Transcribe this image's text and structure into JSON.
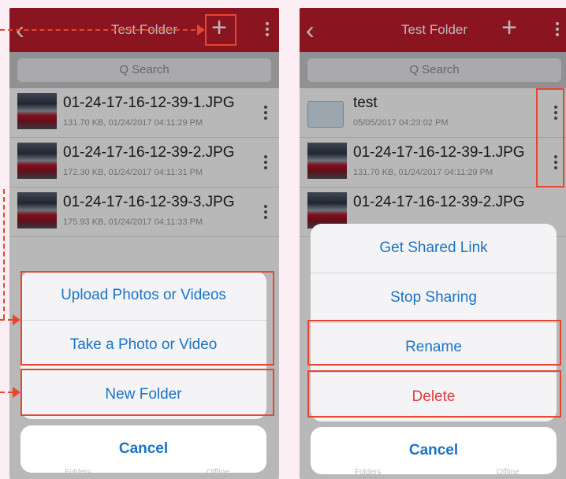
{
  "left": {
    "nav": {
      "title": "Test Folder",
      "back": "‹",
      "add": "+"
    },
    "search": {
      "placeholder": "Q Search"
    },
    "files": [
      {
        "name": "01-24-17-16-12-39-1.JPG",
        "meta": "131.70 KB, 01/24/2017 04:11:29 PM"
      },
      {
        "name": "01-24-17-16-12-39-2.JPG",
        "meta": "172.30 KB, 01/24/2017 04:11:31 PM"
      },
      {
        "name": "01-24-17-16-12-39-3.JPG",
        "meta": "175.93 KB, 01/24/2017 04:11:33 PM"
      }
    ],
    "sheet": {
      "items": [
        "Upload Photos or Videos",
        "Take a Photo or Video",
        "New Folder"
      ],
      "cancel": "Cancel"
    },
    "tabs": {
      "folders": "Folders",
      "offline": "Offline"
    }
  },
  "right": {
    "nav": {
      "title": "Test Folder",
      "back": "‹",
      "add": "+"
    },
    "search": {
      "placeholder": "Q Search"
    },
    "folder": {
      "name": "test",
      "meta": "05/05/2017 04:23:02 PM"
    },
    "files": [
      {
        "name": "01-24-17-16-12-39-1.JPG",
        "meta": "131.70 KB, 01/24/2017 04:11:29 PM"
      },
      {
        "name": "01-24-17-16-12-39-2.JPG",
        "meta": ""
      }
    ],
    "sheet": {
      "items": [
        "Get Shared Link",
        "Stop Sharing",
        "Rename",
        "Delete"
      ],
      "cancel": "Cancel"
    },
    "tabs": {
      "folders": "Folders",
      "offline": "Offline"
    }
  },
  "colors": {
    "nav": "#bf1e2e",
    "action": "#1a73c7",
    "destructive": "#e43a3a",
    "highlight": "#e8462e"
  },
  "icons": [
    "back-chevron-icon",
    "plus-icon",
    "more-vertical-icon",
    "search-icon",
    "link-icon",
    "folder-icon"
  ]
}
